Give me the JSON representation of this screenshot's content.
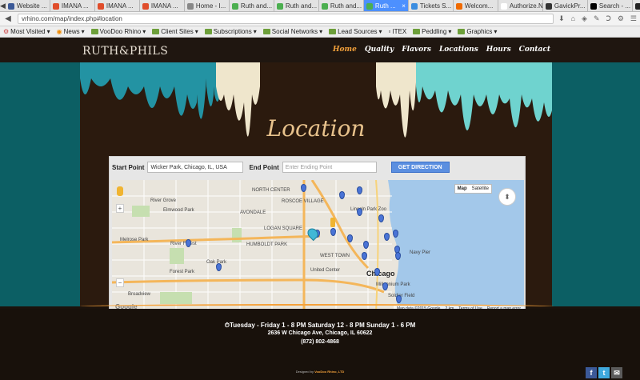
{
  "browser": {
    "tabs": [
      {
        "label": "Website ...",
        "color": "#3b5998"
      },
      {
        "label": "IMANA ...",
        "color": "#e04d2b"
      },
      {
        "label": "IMANA ...",
        "color": "#e04d2b"
      },
      {
        "label": "IMANA ...",
        "color": "#e04d2b"
      },
      {
        "label": "Home - I...",
        "color": "#888888"
      },
      {
        "label": "Ruth and...",
        "color": "#4caf50"
      },
      {
        "label": "Ruth and...",
        "color": "#4caf50"
      },
      {
        "label": "Ruth and...",
        "color": "#4caf50"
      },
      {
        "label": "Ruth ...",
        "color": "#4caf50",
        "active": true
      },
      {
        "label": "Tickets S...",
        "color": "#3b8de0"
      },
      {
        "label": "Welcom...",
        "color": "#f06a00"
      },
      {
        "label": "Authorize.Net",
        "color": "#ffffff"
      },
      {
        "label": "GavickPr...",
        "color": "#333333"
      },
      {
        "label": "Search - ...",
        "color": "#000000"
      },
      {
        "label": "JoomlaXTC",
        "color": "#222222"
      },
      {
        "label": "GreenGee...",
        "color": "#2d8c2d"
      }
    ],
    "url": "vrhino.com/map/index.php#location"
  },
  "bookmarks": [
    {
      "label": "Most Visited",
      "icon": "gear-icon"
    },
    {
      "label": "News",
      "icon": "rss-icon"
    },
    {
      "label": "VooDoo Rhino",
      "icon": "folder-icon"
    },
    {
      "label": "Client Sites",
      "icon": "folder-icon"
    },
    {
      "label": "Subscriptions",
      "icon": "folder-icon"
    },
    {
      "label": "Social Networks",
      "icon": "folder-icon"
    },
    {
      "label": "Lead Sources",
      "icon": "folder-icon"
    },
    {
      "label": "ITEX",
      "icon": "page-icon"
    },
    {
      "label": "Peddling",
      "icon": "folder-icon"
    },
    {
      "label": "Graphics",
      "icon": "folder-icon"
    }
  ],
  "site": {
    "logo": "RUTH&PHILS",
    "menu": [
      {
        "label": "Home",
        "active": true
      },
      {
        "label": "Quality"
      },
      {
        "label": "Flavors"
      },
      {
        "label": "Locations"
      },
      {
        "label": "Hours"
      },
      {
        "label": "Contact"
      }
    ],
    "hero_title": "Location"
  },
  "directions": {
    "start_label": "Start Point",
    "start_value": "Wicker Park, Chicago, IL, USA",
    "end_label": "End Point",
    "end_placeholder": "Enter Ending Point",
    "button_label": "GET DIRECTION"
  },
  "map": {
    "type_options": [
      "Map",
      "Satellite"
    ],
    "selected_type": "Map",
    "labels": [
      "River Grove",
      "Elmwood Park",
      "Melrose Park",
      "River Forest",
      "Oak Park",
      "Forest Park",
      "Broadview",
      "Chicago",
      "Lincoln Park Zoo",
      "United Center",
      "NORTH CENTER",
      "ROSCOE VILLAGE",
      "AVONDALE",
      "LOGAN SQUARE",
      "HUMBOLDT PARK",
      "WEST TOWN",
      "Navy Pier",
      "Millennium Park",
      "Soldier Field"
    ],
    "footer": [
      "Map data ©2015 Google",
      "2 km",
      "Terms of Use",
      "Report a map error"
    ],
    "google": "Google",
    "zoom_in": "+",
    "zoom_out": "−",
    "pan": "⬍"
  },
  "footer": {
    "hours": "Tuesday - Friday 1 - 8 PM    Saturday 12 - 8 PM    Sunday 1 - 6 PM",
    "address": "2636 W Chicago Ave, Chicago, IL 60622",
    "phone": "(872) 802-4868",
    "credit_prefix": "Designed by",
    "credit_name": "VooDoo Rhino, LTD",
    "social": [
      "f",
      "t",
      "✉"
    ]
  },
  "colors": {
    "accent": "#f5a23b",
    "teal": "#0c5f64",
    "pin": "#4a74d6"
  }
}
